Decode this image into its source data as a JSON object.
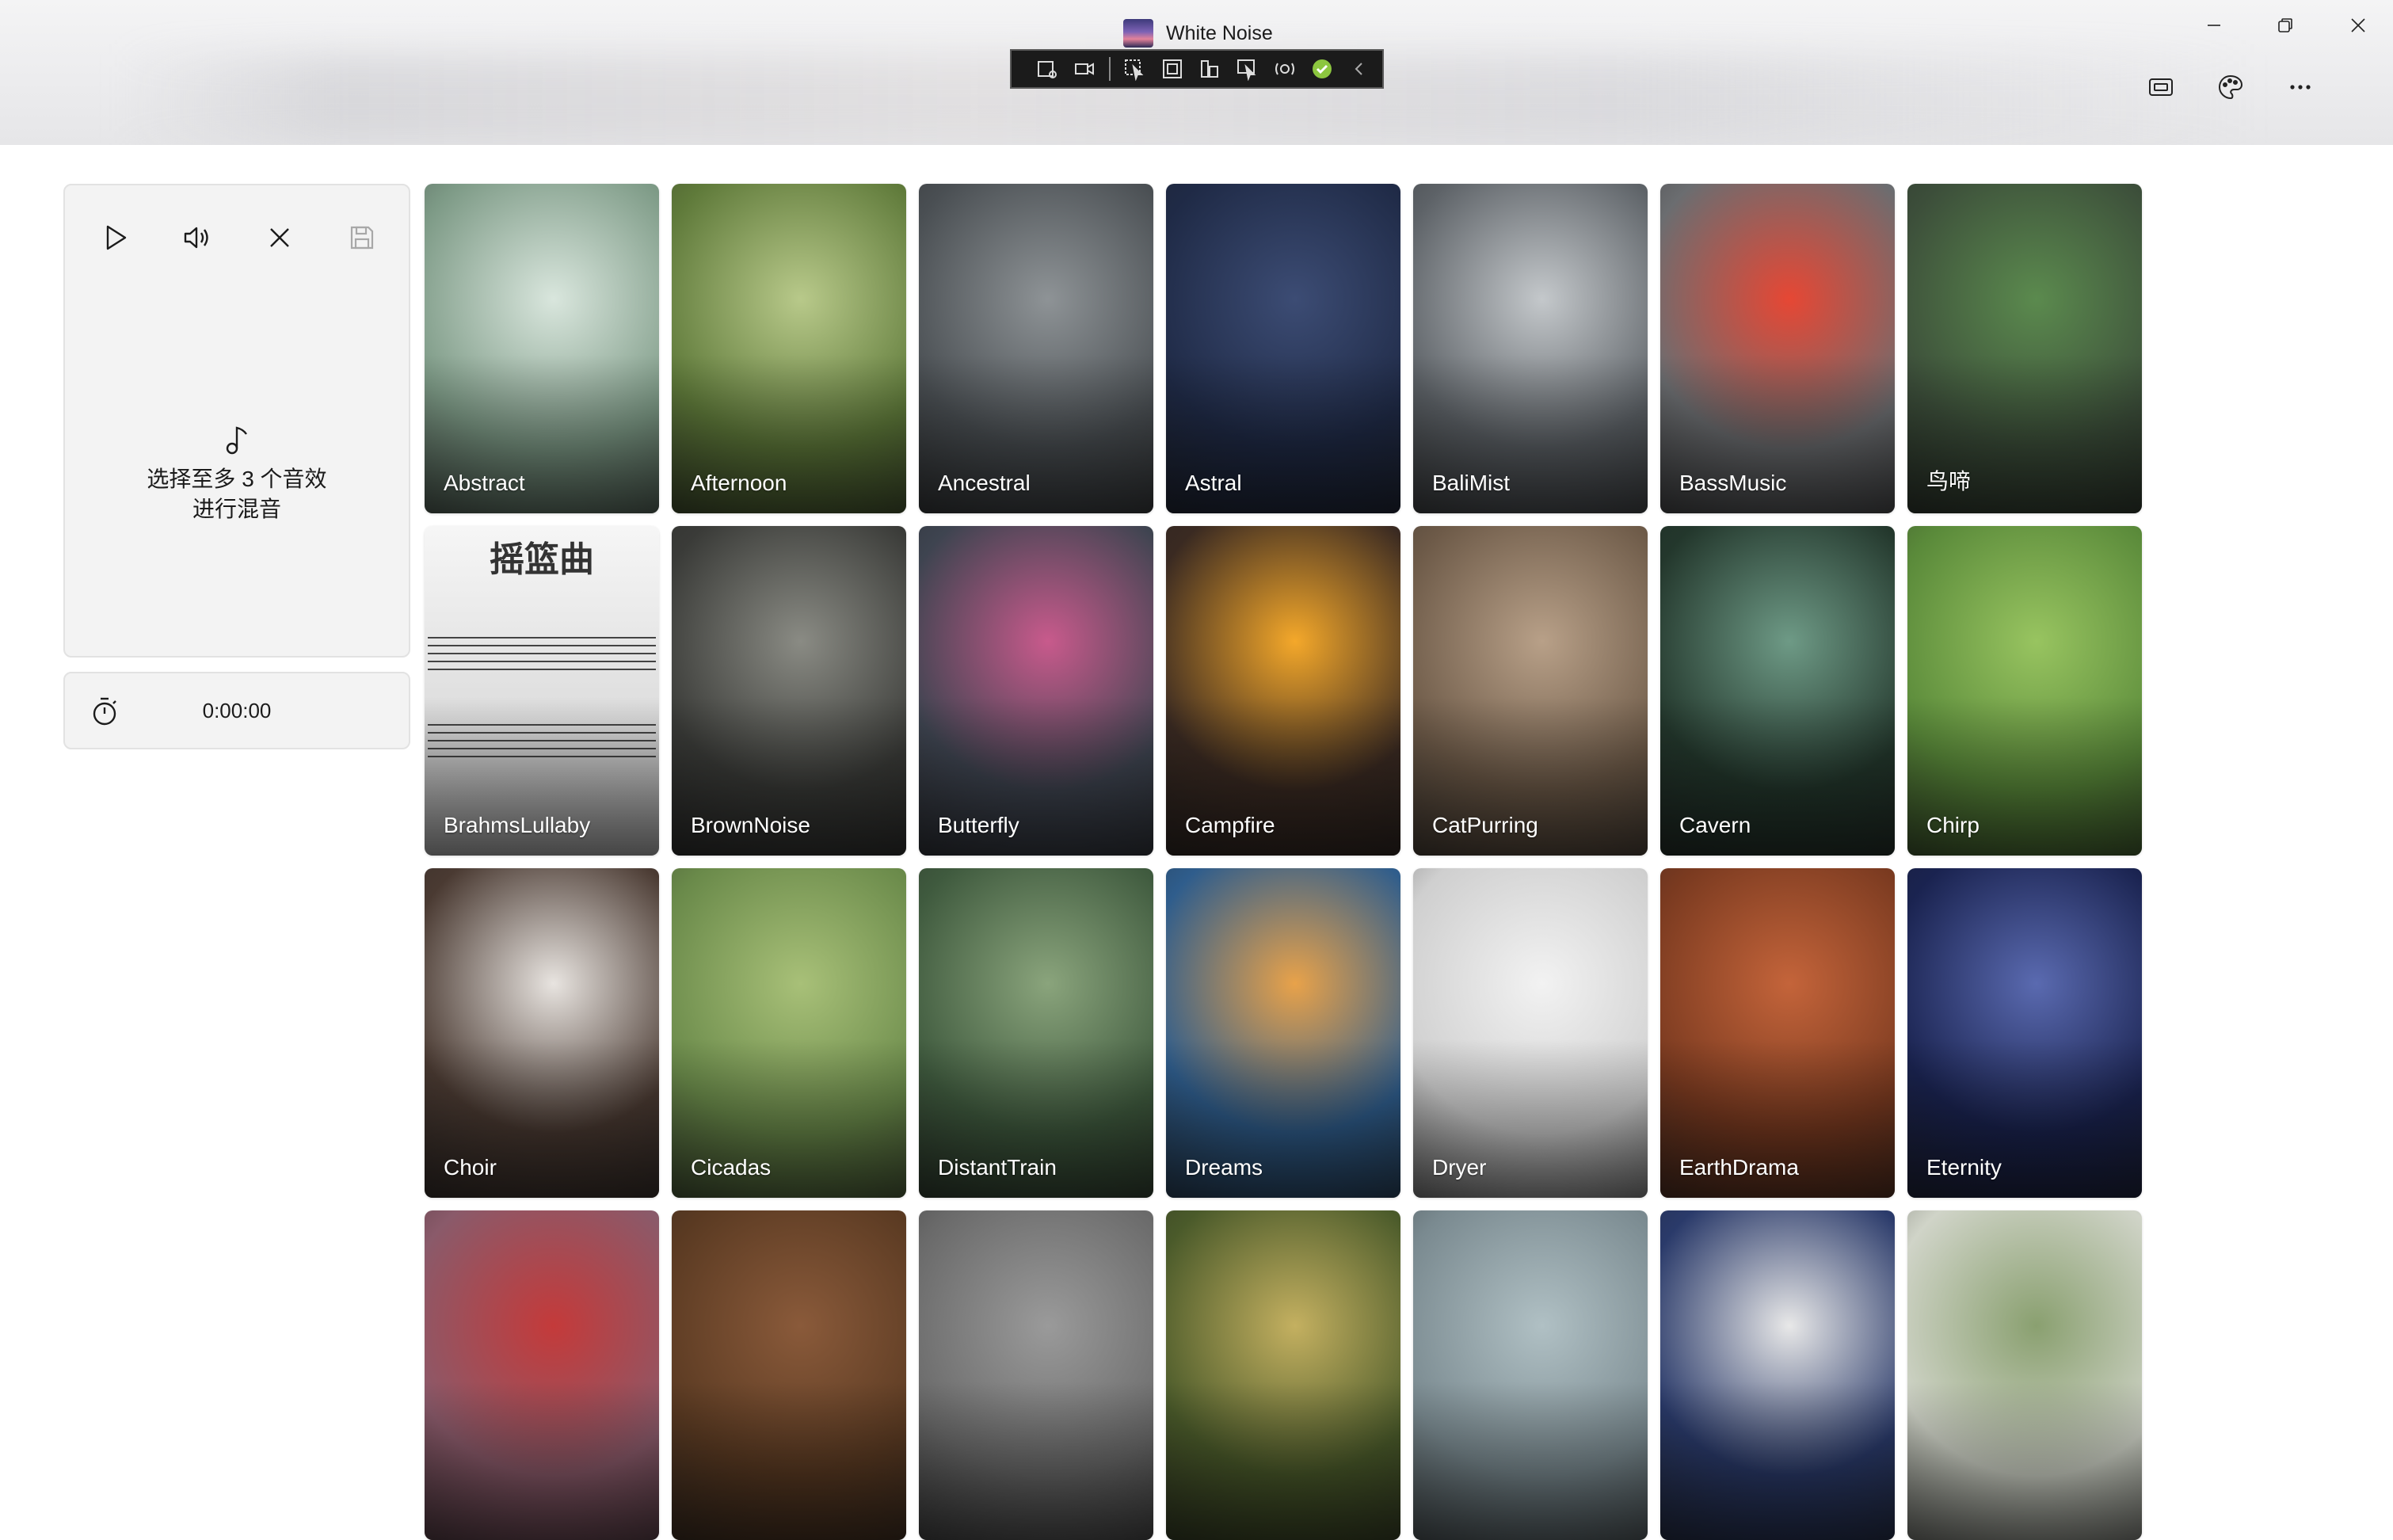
{
  "window": {
    "title": "White Noise"
  },
  "debug_toolbar": {
    "icons": [
      "live-visual-tree-icon",
      "record-icon",
      "select-element-icon",
      "display-layout-adorners-icon",
      "track-focused-element-icon",
      "preview-selection-icon",
      "hot-reload-icon",
      "hot-reload-status-icon",
      "collapse-icon"
    ]
  },
  "header_actions": [
    "compact-overlay-icon",
    "theme-palette-icon",
    "more-options-icon"
  ],
  "mixer": {
    "controls": [
      "play-icon",
      "volume-icon",
      "clear-icon",
      "save-icon"
    ],
    "empty_line1": "选择至多 3 个音效",
    "empty_line2": "进行混音"
  },
  "timer": {
    "value": "0:00:00"
  },
  "sounds": [
    {
      "label": "Abstract",
      "bg": "#7d9a86",
      "accent": "#d9e6dd"
    },
    {
      "label": "Afternoon",
      "bg": "#5f7a3a",
      "accent": "#b8c98a"
    },
    {
      "label": "Ancestral",
      "bg": "#4a4f53",
      "accent": "#8e9396"
    },
    {
      "label": "Astral",
      "bg": "#1f2a46",
      "accent": "#3c4c74"
    },
    {
      "label": "BaliMist",
      "bg": "#5d6267",
      "accent": "#c4c8cb"
    },
    {
      "label": "BassMusic",
      "bg": "#6b6d70",
      "accent": "#e64734"
    },
    {
      "label": "鸟啼",
      "bg": "#3c4e3a",
      "accent": "#5b8a4e"
    },
    {
      "label": "BrahmsLullaby",
      "bg": "#cfcfcf",
      "accent": "#f4f4f4",
      "lullaby": "摇篮曲"
    },
    {
      "label": "BrownNoise",
      "bg": "#3a3b38",
      "accent": "#8a8b84"
    },
    {
      "label": "Butterfly",
      "bg": "#3e4450",
      "accent": "#c85a8c"
    },
    {
      "label": "Campfire",
      "bg": "#3a2a22",
      "accent": "#f4a82a"
    },
    {
      "label": "CatPurring",
      "bg": "#6d5a48",
      "accent": "#b8a088"
    },
    {
      "label": "Cavern",
      "bg": "#23372c",
      "accent": "#6e9a86"
    },
    {
      "label": "Chirp",
      "bg": "#5a8a3a",
      "accent": "#98c460"
    },
    {
      "label": "Choir",
      "bg": "#4a3a32",
      "accent": "#e8e4e0"
    },
    {
      "label": "Cicadas",
      "bg": "#6a8a4a",
      "accent": "#a8c078"
    },
    {
      "label": "DistantTrain",
      "bg": "#3f5a3e",
      "accent": "#8aa47c"
    },
    {
      "label": "Dreams",
      "bg": "#2f5d8c",
      "accent": "#e8a24a"
    },
    {
      "label": "Dryer",
      "bg": "#cfcfcf",
      "accent": "#f2f2f2"
    },
    {
      "label": "EarthDrama",
      "bg": "#7a3a20",
      "accent": "#c4643a"
    },
    {
      "label": "Eternity",
      "bg": "#1a2350",
      "accent": "#5a6ab0"
    },
    {
      "label": "",
      "bg": "#8a5a6a",
      "accent": "#c43a3a"
    },
    {
      "label": "",
      "bg": "#5a3a22",
      "accent": "#8a5a3a"
    },
    {
      "label": "",
      "bg": "#6a6a6a",
      "accent": "#9a9a9a"
    },
    {
      "label": "",
      "bg": "#4a5a2a",
      "accent": "#c4b060"
    },
    {
      "label": "",
      "bg": "#7a8a90",
      "accent": "#b0c0c4"
    },
    {
      "label": "",
      "bg": "#2a3a6a",
      "accent": "#e8e8e8"
    },
    {
      "label": "",
      "bg": "#d0d4c8",
      "accent": "#8aa070"
    }
  ]
}
